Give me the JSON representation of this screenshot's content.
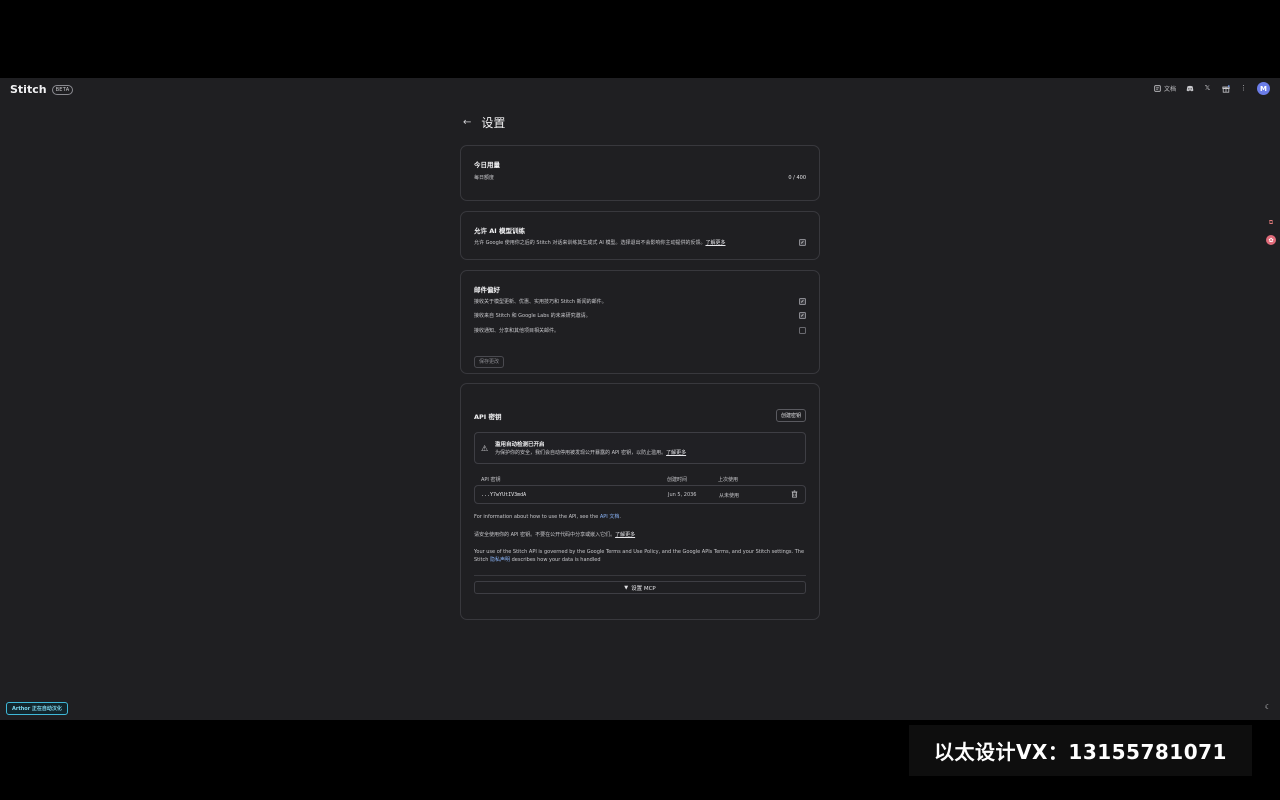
{
  "app": {
    "name": "Stitch",
    "badge": "BETA"
  },
  "topbar": {
    "docs_label": "文档",
    "avatar_initial": "M"
  },
  "page": {
    "title": "设置"
  },
  "usage": {
    "title": "今日用量",
    "label": "每日额度",
    "value": "0 / 400"
  },
  "training": {
    "title": "允许 AI 模型训练",
    "desc": "允许 Google 使用你之后的 Stitch 对话来训练其生成式 AI 模型。选择退出不会影响你主动提供的反馈。",
    "link": "了解更多",
    "checked": true
  },
  "email": {
    "title": "邮件偏好",
    "items": [
      {
        "label": "接收关于模型更新、优惠、实用技巧和 Stitch 新闻的邮件。",
        "checked": true
      },
      {
        "label": "接收来自 Stitch 和 Google Labs 的未来研究邀请。",
        "checked": true
      },
      {
        "label": "接收通知、分享和其他项目相关邮件。",
        "checked": false
      }
    ],
    "save_label": "保存更改"
  },
  "api": {
    "title": "API 密钥",
    "create_label": "创建密钥",
    "alert_title": "滥用自动检测已开启",
    "alert_desc": "为保护你的安全，我们会自动停用被发现公开暴露的 API 密钥，以防止滥用。",
    "alert_link": "了解更多",
    "columns": [
      "API 密钥",
      "创建时间",
      "上次使用"
    ],
    "keys": [
      {
        "key": "...Y7wYUtIV3mdA",
        "created": "Jun 5, 2036",
        "last_used": "从未使用"
      }
    ],
    "info_text": "For information about how to use the API, see the",
    "info_link": "API 文档",
    "safety_text": "请安全使用你的 API 密钥。不要在公开代码中分享或嵌入它们。",
    "safety_link": "了解更多",
    "terms_text": "Your use of the Stitch API is governed by the Google Terms and Use Policy, and the Google APIs Terms, and your Stitch settings. The Stitch",
    "terms_link": "隐私声明",
    "terms_tail": "describes how your data is handled",
    "mcp_label": "设置 MCP"
  },
  "extension": {
    "label": "Arthor 正在自动汉化"
  },
  "watermark": {
    "text": "以太设计VX：13155781071"
  }
}
